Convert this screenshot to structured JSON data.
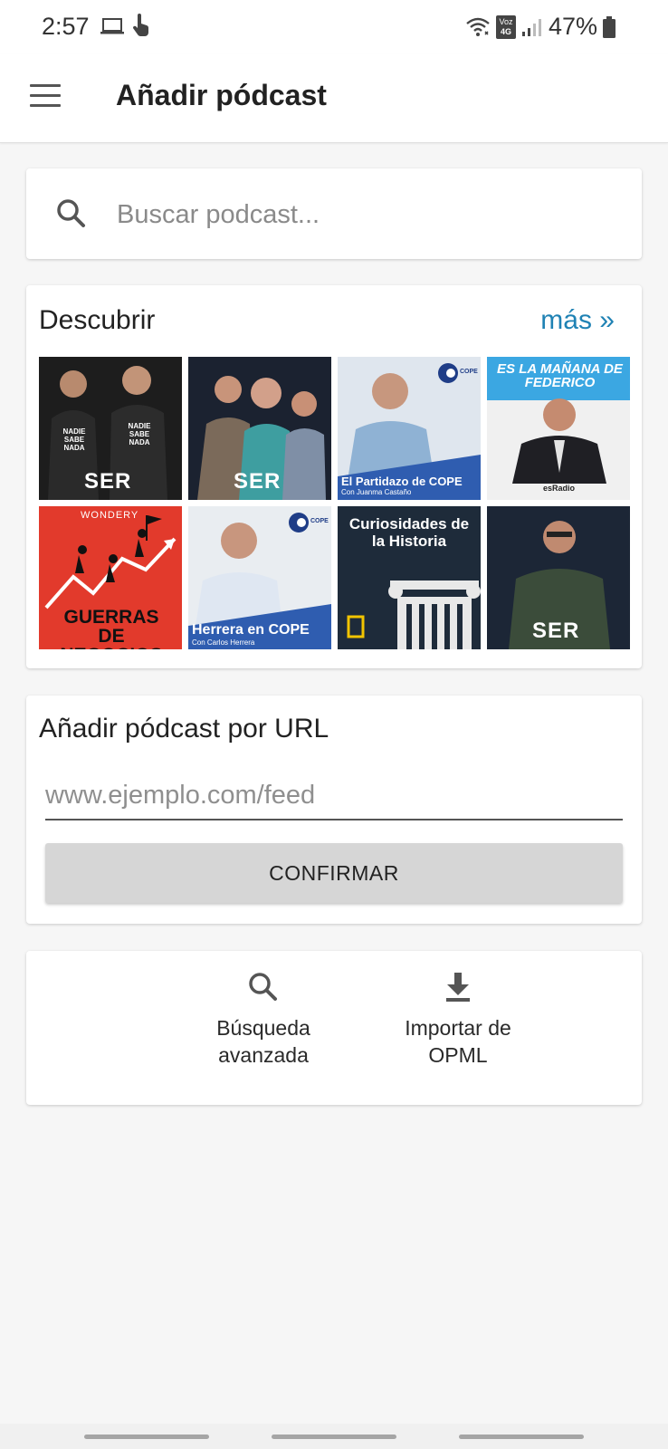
{
  "status_bar": {
    "time": "2:57",
    "network_label_top": "Voz",
    "network_label_bottom": "4G",
    "battery": "47%",
    "icons": [
      "laptop-icon",
      "touch-hand-icon",
      "wifi-icon",
      "volte-icon",
      "signal-icon",
      "battery-icon"
    ]
  },
  "app_bar": {
    "title": "Añadir pódcast",
    "menu_icon": "hamburger-menu-icon"
  },
  "search": {
    "placeholder": "Buscar podcast...",
    "icon": "search-icon"
  },
  "discover": {
    "title": "Descubrir",
    "more_link": "más »",
    "podcasts": [
      {
        "badge": "SER",
        "shirt_text_1": "NADIE SABE NADA",
        "shirt_text_2": "NADIE SABE NADA",
        "bg": "#1d1d1d"
      },
      {
        "badge": "SER",
        "bg": "#1b2230"
      },
      {
        "brand": "COPE",
        "title": "El Partidazo de COPE",
        "subtitle": "Con Juanma Castaño",
        "bg": "#dfe6ee"
      },
      {
        "title": "ES LA MAÑANA DE FEDERICO",
        "brand": "esRadio",
        "bg": "#3ba7e2"
      },
      {
        "brand": "WONDERY",
        "title": "GUERRAS DE NEGOCIOS",
        "bg": "#e23a2c"
      },
      {
        "brand": "COPE",
        "title": "Herrera en COPE",
        "subtitle": "Con Carlos Herrera",
        "bg": "#e9edf1"
      },
      {
        "title": "Curiosidades de la Historia",
        "bg": "#1e2b3a"
      },
      {
        "badge": "SER",
        "bg": "#1c2636"
      }
    ]
  },
  "url_section": {
    "title": "Añadir pódcast por URL",
    "placeholder": "www.ejemplo.com/feed",
    "confirm_label": "CONFIRMAR"
  },
  "actions": {
    "advanced_search_line1": "Búsqueda",
    "advanced_search_line2": "avanzada",
    "import_line1": "Importar de",
    "import_line2": "OPML"
  }
}
